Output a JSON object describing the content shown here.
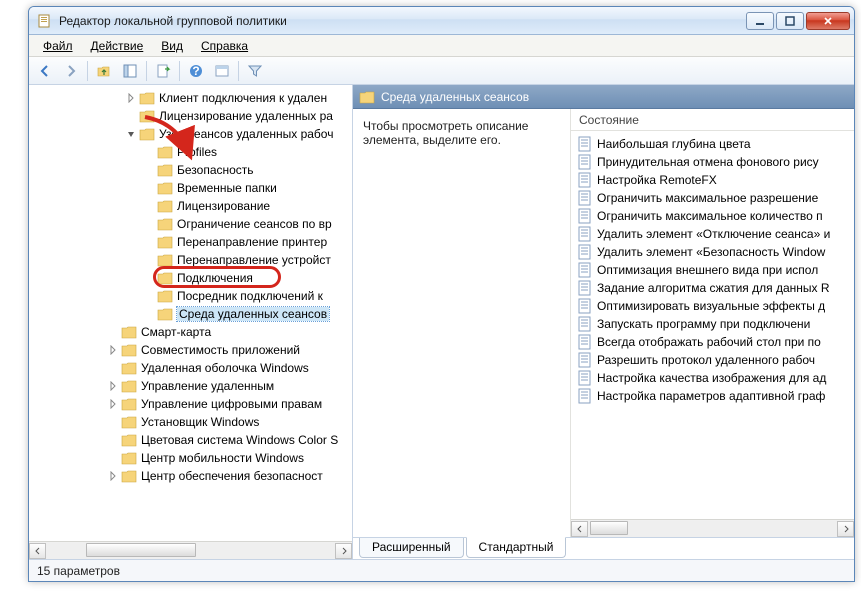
{
  "window": {
    "title": "Редактор локальной групповой политики"
  },
  "menu": {
    "file": "Файл",
    "action": "Действие",
    "view": "Вид",
    "help": "Справка"
  },
  "tree": {
    "items": [
      {
        "indent": 96,
        "exp": "closed",
        "label": "Клиент подключения к удален"
      },
      {
        "indent": 96,
        "exp": "none",
        "label": "Лицензирование удаленных ра"
      },
      {
        "indent": 96,
        "exp": "open",
        "label": "Узел сеансов удаленных рабоч"
      },
      {
        "indent": 114,
        "exp": "none",
        "label": "Profiles"
      },
      {
        "indent": 114,
        "exp": "none",
        "label": "Безопасность"
      },
      {
        "indent": 114,
        "exp": "none",
        "label": "Временные папки"
      },
      {
        "indent": 114,
        "exp": "none",
        "label": "Лицензирование"
      },
      {
        "indent": 114,
        "exp": "none",
        "label": "Ограничение сеансов по вр"
      },
      {
        "indent": 114,
        "exp": "none",
        "label": "Перенаправление принтер"
      },
      {
        "indent": 114,
        "exp": "none",
        "label": "Перенаправление устройст"
      },
      {
        "indent": 114,
        "exp": "none",
        "label": "Подключения",
        "highlight": true
      },
      {
        "indent": 114,
        "exp": "none",
        "label": "Посредник подключений к"
      },
      {
        "indent": 114,
        "exp": "none",
        "label": "Среда удаленных сеансов",
        "selected": true
      },
      {
        "indent": 78,
        "exp": "none",
        "label": "Смарт-карта"
      },
      {
        "indent": 78,
        "exp": "closed",
        "label": "Совместимость приложений"
      },
      {
        "indent": 78,
        "exp": "none",
        "label": "Удаленная оболочка Windows"
      },
      {
        "indent": 78,
        "exp": "closed",
        "label": "Управление удаленным"
      },
      {
        "indent": 78,
        "exp": "closed",
        "label": "Управление цифровыми правам"
      },
      {
        "indent": 78,
        "exp": "none",
        "label": "Установщик Windows"
      },
      {
        "indent": 78,
        "exp": "none",
        "label": "Цветовая система Windows Color S"
      },
      {
        "indent": 78,
        "exp": "none",
        "label": "Центр мобильности Windows"
      },
      {
        "indent": 78,
        "exp": "closed",
        "label": "Центр обеспечения безопасност"
      }
    ]
  },
  "right": {
    "header": "Среда удаленных сеансов",
    "desc": "Чтобы просмотреть описание элемента, выделите его.",
    "col": "Состояние",
    "items": [
      "Наибольшая глубина цвета",
      "Принудительная отмена фонового рису",
      "Настройка RemoteFX",
      "Ограничить максимальное разрешение",
      "Ограничить максимальное количество п",
      "Удалить элемент «Отключение сеанса» и",
      "Удалить элемент «Безопасность Window",
      "Оптимизация внешнего вида при испол",
      "Задание алгоритма сжатия для данных R",
      "Оптимизировать визуальные эффекты д",
      "Запускать программу при подключени",
      "Всегда отображать рабочий стол при по",
      "Разрешить протокол удаленного рабоч",
      "Настройка качества изображения для ад",
      "Настройка параметров адаптивной граф"
    ]
  },
  "tabs": {
    "extended": "Расширенный",
    "standard": "Стандартный"
  },
  "status": "15 параметров"
}
